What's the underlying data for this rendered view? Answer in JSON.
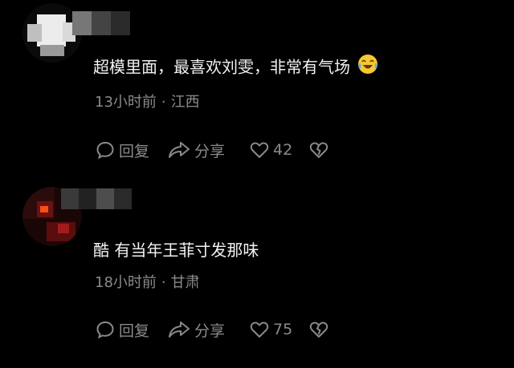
{
  "comments": [
    {
      "text": "超模里面，最喜欢刘雯，非常有气场",
      "emoji": "laughing-crying-emoji",
      "time": "13小时前",
      "separator": "·",
      "location": "江西",
      "reply_label": "回复",
      "share_label": "分享",
      "like_count": "42",
      "avatar": "pixelated-avatar-light"
    },
    {
      "text": "酷 有当年王菲寸发那味",
      "time": "18小时前",
      "separator": "·",
      "location": "甘肃",
      "reply_label": "回复",
      "share_label": "分享",
      "like_count": "75",
      "avatar": "pixelated-avatar-red"
    }
  ],
  "icons": {
    "reply": "comment-bubble-icon",
    "share": "share-arrow-icon",
    "like": "heart-icon",
    "dislike": "broken-heart-icon"
  },
  "colors": {
    "background": "#000000",
    "text": "#f2f2f2",
    "meta": "#8a8a8a"
  }
}
